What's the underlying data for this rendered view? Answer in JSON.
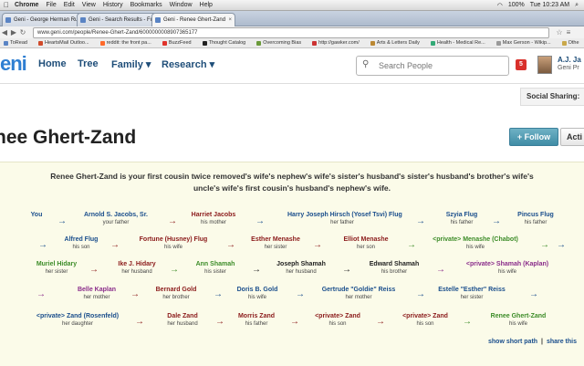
{
  "menubar": {
    "apple": "",
    "items": [
      "Chrome",
      "File",
      "Edit",
      "View",
      "History",
      "Bookmarks",
      "Window",
      "Help"
    ],
    "battery": "100%",
    "clock": "Tue 10:23 AM"
  },
  "tabs": [
    {
      "label": "Geni - George Herman Ru..."
    },
    {
      "label": "Geni - Search Results - Fu..."
    },
    {
      "label": "Geni - Renee Ghert-Zand"
    }
  ],
  "address": {
    "url": "www.geni.com/people/Renee-Ghert-Zand/6000000008907365177"
  },
  "bookmarks": [
    "ToRead",
    "HeartsMail Outloo...",
    "reddit: the front pa...",
    "BuzzFeed",
    "Thought Catalog",
    "Overcoming Bias",
    "http://gawker.com/",
    "Arts & Letters Daily",
    "Health - Medical Re...",
    "Max Gerson - Wikip...",
    "Othe"
  ],
  "geni": {
    "logo": "eni",
    "nav": [
      "Home",
      "Tree",
      "Family ▾",
      "Research ▾"
    ],
    "search_placeholder": "Search People",
    "notifications": "5",
    "user_name": "A.J. Ja",
    "user_plan": "Geni Pr"
  },
  "social_label": "Social Sharing:",
  "profile": {
    "title": "nee Ghert-Zand",
    "follow_label": "+ Follow",
    "actions_label": "Acti"
  },
  "relationship": {
    "sentence": "Renee Ghert-Zand is your first cousin twice removed's wife's nephew's wife's sister's husband's sister's husband's brother's wife's uncle's wife's first cousin's husband's nephew's wife.",
    "rows": [
      [
        {
          "name": "You",
          "rel": ""
        },
        {
          "name": "Arnold S. Jacobs, Sr.",
          "rel": "your father"
        },
        {
          "name": "Harriet Jacobs",
          "rel": "his mother"
        },
        {
          "name": "Harry Joseph Hirsch (Yosef Tsvi) Flug",
          "rel": "her father"
        },
        {
          "name": "Szyia Flug",
          "rel": "his father"
        },
        {
          "name": "Pincus Flug",
          "rel": "his father"
        }
      ],
      [
        {
          "name": "Alfred Flug",
          "rel": "his son"
        },
        {
          "name": "Fortune (Husney) Flug",
          "rel": "his wife"
        },
        {
          "name": "Esther Menashe",
          "rel": "her sister"
        },
        {
          "name": "Elliot Menashe",
          "rel": "her son"
        },
        {
          "name": "<private> Menashe (Chabot)",
          "rel": "his wife"
        }
      ],
      [
        {
          "name": "Muriel Hidary",
          "rel": "her sister"
        },
        {
          "name": "Ike J. Hidary",
          "rel": "her husband"
        },
        {
          "name": "Ann Shamah",
          "rel": "his sister"
        },
        {
          "name": "Joseph Shamah",
          "rel": "her husband"
        },
        {
          "name": "Edward Shamah",
          "rel": "his brother"
        },
        {
          "name": "<private> Shamah (Kaplan)",
          "rel": "his wife"
        }
      ],
      [
        {
          "name": "Belle Kaplan",
          "rel": "her mother"
        },
        {
          "name": "Bernard Gold",
          "rel": "her brother"
        },
        {
          "name": "Doris B. Gold",
          "rel": "his wife"
        },
        {
          "name": "Gertrude \"Goldie\" Reiss",
          "rel": "her mother"
        },
        {
          "name": "Estelle \"Esther\" Reiss",
          "rel": "her sister"
        }
      ],
      [
        {
          "name": "<private> Zand (Rosenfeld)",
          "rel": "her daughter"
        },
        {
          "name": "Dale Zand",
          "rel": "her husband"
        },
        {
          "name": "Morris Zand",
          "rel": "his father"
        },
        {
          "name": "<private> Zand",
          "rel": "his son"
        },
        {
          "name": "<private> Zand",
          "rel": "his son"
        },
        {
          "name": "Renee Ghert-Zand",
          "rel": "his wife"
        }
      ]
    ],
    "show_short_path": "show short path",
    "separator": "|",
    "share_label": "share this"
  },
  "colors": {
    "male": "#1a4e8c",
    "female": "#8b1a1a",
    "private": "#3c8c28",
    "private_female": "#8a2c8a",
    "geni_blue": "#2f7fd2",
    "panel_bg": "#fbfbe9"
  }
}
